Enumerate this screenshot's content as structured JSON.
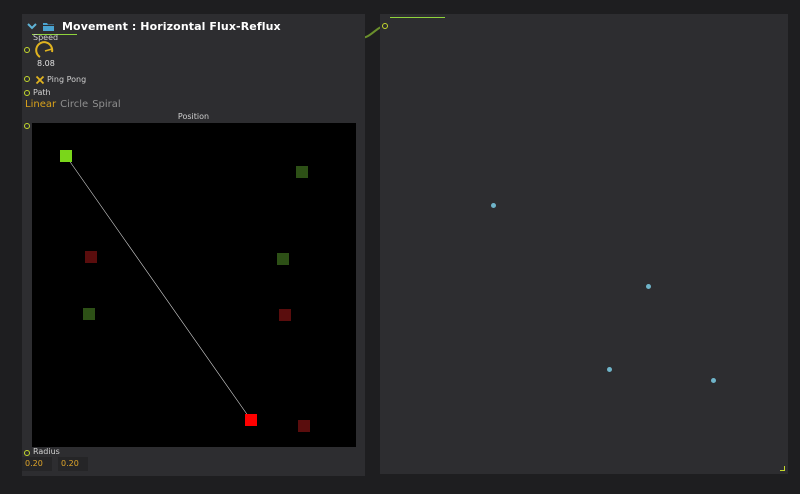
{
  "node": {
    "title": "Movement : Horizontal Flux-Reflux",
    "speed_label": "Speed",
    "speed_value": "8.08",
    "pingpong_label": "Ping Pong",
    "path_label": "Path",
    "path_options": [
      "Linear",
      "Circle",
      "Spiral"
    ],
    "path_selected": "Linear",
    "position_label": "Position",
    "radius_label": "Radius",
    "radius_values": [
      "0.20",
      "0.20"
    ],
    "colors": {
      "accent": "#8fd33c",
      "port": "#c3d82d",
      "active_option": "#d9a21b",
      "start_square": "#7ad61a",
      "end_square": "#ff0000",
      "dim_green": "#2d5016",
      "dim_red": "#5a0d0d"
    }
  },
  "viewer": {
    "dot_color": "#6fb4c9"
  }
}
